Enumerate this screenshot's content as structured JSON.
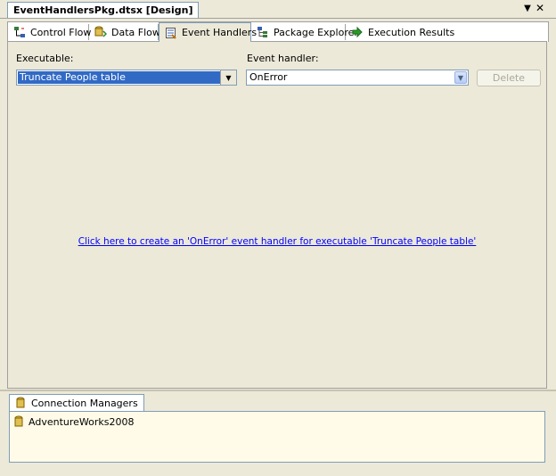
{
  "document": {
    "tab_title": "EventHandlersPkg.dtsx [Design]",
    "chevron_glyph": "▼",
    "close_glyph": "✕"
  },
  "tabs": [
    {
      "label": "Control Flow",
      "icon": "control-flow-icon",
      "active": false
    },
    {
      "label": "Data Flow",
      "icon": "data-flow-icon",
      "active": false
    },
    {
      "label": "Event Handlers",
      "icon": "event-handlers-icon",
      "active": true
    },
    {
      "label": "Package Explorer",
      "icon": "package-explorer-icon",
      "active": false
    },
    {
      "label": "Execution Results",
      "icon": "execution-results-icon",
      "active": false
    }
  ],
  "executable": {
    "label": "Executable:",
    "value": "Truncate People table"
  },
  "event_handler": {
    "label": "Event handler:",
    "value": "OnError"
  },
  "delete_label": "Delete",
  "create_link": "Click here to create an 'OnError' event handler for executable 'Truncate People table'",
  "connection_managers": {
    "tab_label": "Connection Managers",
    "items": [
      "AdventureWorks2008"
    ]
  },
  "colors": {
    "selection": "#316ac5",
    "link": "#0000ff",
    "panel_bg": "#ece9d8",
    "cm_bg": "#fffbe8"
  }
}
